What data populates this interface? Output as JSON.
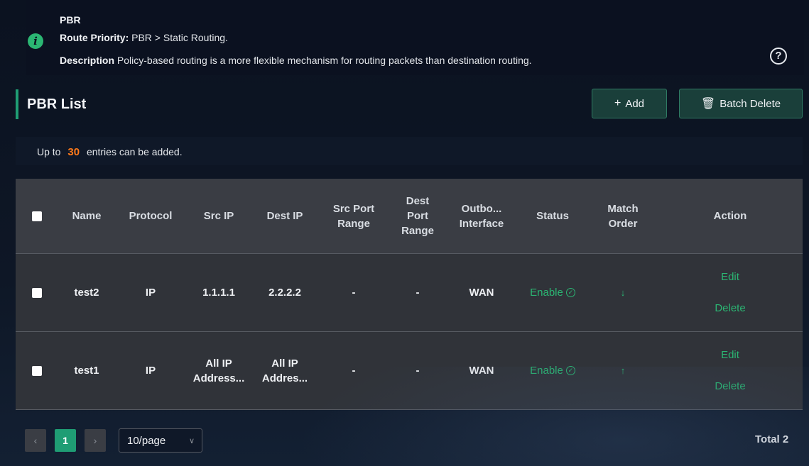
{
  "banner": {
    "title": "PBR",
    "priority_label": "Route Priority:",
    "priority_value": " PBR > Static Routing.",
    "description_label": "Description",
    "description_value": " Policy-based routing is a more flexible mechanism for routing packets than destination routing."
  },
  "list": {
    "title": "PBR List",
    "add_label": "Add",
    "batch_delete_label": "Batch Delete",
    "limit_prefix": "Up to",
    "limit_count": "30",
    "limit_suffix": "entries can be added."
  },
  "table": {
    "columns": {
      "name": "Name",
      "protocol": "Protocol",
      "src_ip": "Src IP",
      "dest_ip": "Dest IP",
      "src_port_range_1": "Src Port",
      "src_port_range_2": "Range",
      "dest_port_range_1": "Dest",
      "dest_port_range_2": "Port",
      "dest_port_range_3": "Range",
      "outbound_1": "Outbo...",
      "outbound_2": "Interface",
      "status": "Status",
      "match_order_1": "Match",
      "match_order_2": "Order",
      "action": "Action"
    },
    "rows": [
      {
        "name": "test2",
        "protocol": "IP",
        "src_ip_1": "1.1.1.1",
        "src_ip_2": "",
        "dest_ip_1": "2.2.2.2",
        "dest_ip_2": "",
        "src_port_range": "-",
        "dest_port_range": "-",
        "outbound": "WAN",
        "status": "Enable",
        "match_order_icon": "↓",
        "edit": "Edit",
        "delete": "Delete"
      },
      {
        "name": "test1",
        "protocol": "IP",
        "src_ip_1": "All IP",
        "src_ip_2": "Address...",
        "dest_ip_1": "All IP",
        "dest_ip_2": "Addres...",
        "src_port_range": "-",
        "dest_port_range": "-",
        "outbound": "WAN",
        "status": "Enable",
        "match_order_icon": "↑",
        "edit": "Edit",
        "delete": "Delete"
      }
    ]
  },
  "pagination": {
    "current_page": "1",
    "page_size": "10/page",
    "total": "Total 2"
  },
  "colors": {
    "accent": "#2bb673",
    "limit_highlight": "#ff7a1a"
  }
}
